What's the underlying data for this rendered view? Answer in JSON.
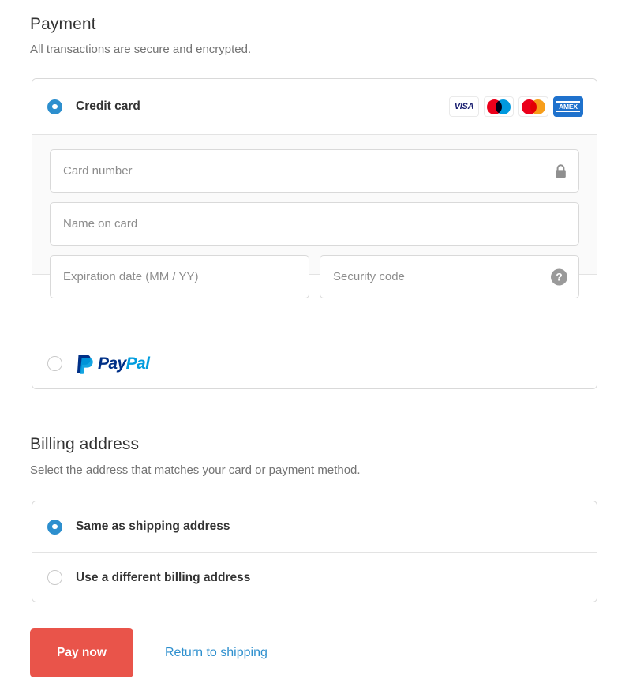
{
  "payment": {
    "title": "Payment",
    "subtitle": "All transactions are secure and encrypted.",
    "methods": {
      "credit_card": {
        "label": "Credit card",
        "selected": true,
        "brands": [
          {
            "name": "visa-logo",
            "text": "VISA"
          },
          {
            "name": "maestro-logo",
            "text": ""
          },
          {
            "name": "mastercard-logo",
            "text": ""
          },
          {
            "name": "amex-logo",
            "text": "AMEX"
          }
        ],
        "fields": {
          "card_number": {
            "placeholder": "Card number",
            "value": "",
            "icon": "lock-icon"
          },
          "name_on_card": {
            "placeholder": "Name on card",
            "value": ""
          },
          "expiration": {
            "placeholder": "Expiration date (MM / YY)",
            "value": ""
          },
          "security_code": {
            "placeholder": "Security code",
            "value": "",
            "icon": "help-icon",
            "icon_glyph": "?"
          }
        }
      },
      "paypal": {
        "label_part1": "Pay",
        "label_part2": "Pal",
        "selected": false
      }
    }
  },
  "billing": {
    "title": "Billing address",
    "subtitle": "Select the address that matches your card or payment method.",
    "options": [
      {
        "label": "Same as shipping address",
        "selected": true
      },
      {
        "label": "Use a different billing address",
        "selected": false
      }
    ]
  },
  "footer": {
    "pay_button": "Pay now",
    "return_link": "Return to shipping"
  },
  "colors": {
    "accent_blue": "#2d8fce",
    "pay_button_red": "#e9544a",
    "visa_navy": "#1a1f71",
    "amex_blue": "#1f72cd",
    "mastercard_red": "#eb001b",
    "mastercard_orange": "#f79e1b",
    "maestro_blue": "#0099df",
    "paypal_dark": "#003087",
    "paypal_light": "#009cde"
  }
}
